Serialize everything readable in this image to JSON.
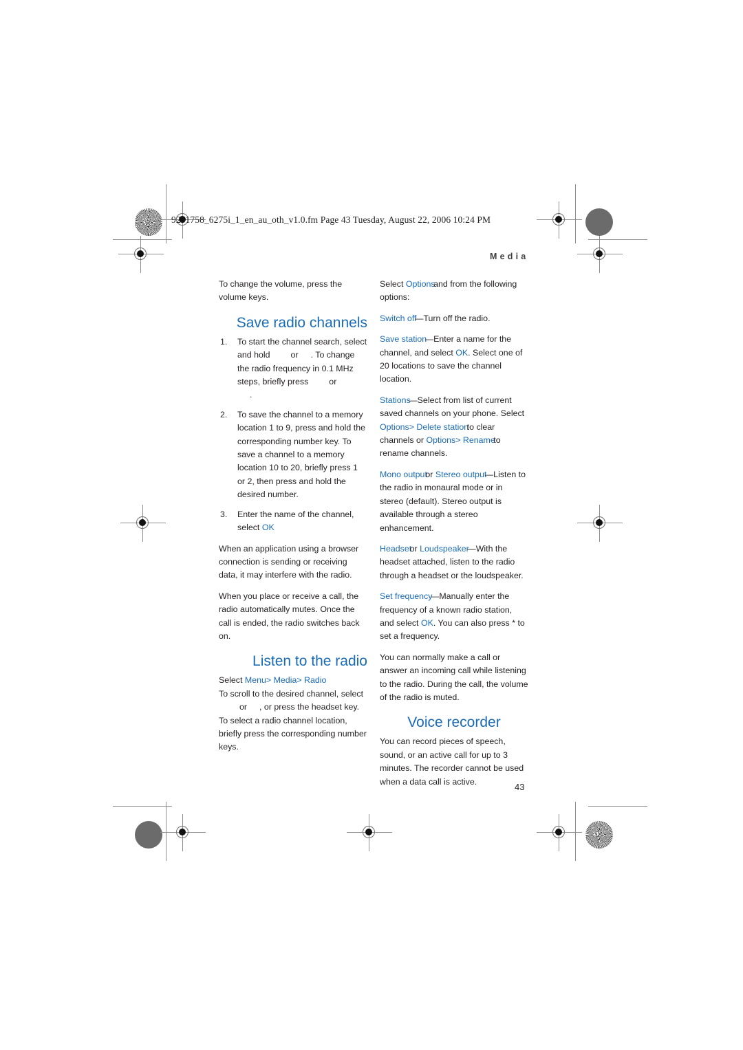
{
  "slug": "9251758_6275i_1_en_au_oth_v1.0.fm  Page 43  Tuesday, August 22, 2006  10:24 PM",
  "running_head": "Media",
  "folio": "43",
  "accent_color": "#1a6bb5",
  "text_color": "#231f20",
  "left_column": {
    "intro_paragraph": "To change the volume, press the volume keys.",
    "heading_save": "Save radio channels",
    "steps": [
      {
        "lines": [
          "To start the channel search,",
          "select and hold",
          "or",
          ".",
          "To change the radio frequency in",
          "0.1 MHz steps, briefly press",
          "or",
          "."
        ],
        "text_a": "To start the channel search, select and hold",
        "text_b": "or",
        "text_c": ".",
        "text_d": "To change the radio frequency in 0.1 MHz steps, briefly press",
        "text_e": "or",
        "text_f": "."
      },
      {
        "text": "To save the channel to a memory location 1 to 9, press and hold the corresponding number key. To save a channel to a memory location 10 to 20, briefly press 1 or 2, then press and hold the desired number."
      },
      {
        "text_before": "Enter the name of the channel, select",
        "ui": "OK"
      }
    ],
    "paragraph_browser": "When an application using a browser connection is sending or receiving data, it may interfere with the radio.",
    "paragraph_call": "When you place or receive a call, the radio automatically mutes. Once the call is ended, the radio switches back on.",
    "heading_listen": "Listen to the radio",
    "listen_select_label": "Select",
    "listen_ui_menu": "Menu",
    "listen_sep1": ">",
    "listen_ui_media": "Media",
    "listen_sep2": ">",
    "listen_ui_radio": "Radio",
    "listen_body_a": "To scroll to the desired channel, select",
    "listen_body_b": "or",
    "listen_body_c": ", or press the headset key. To select a radio channel location, briefly press the corresponding number keys."
  },
  "right_column": {
    "intro_select": "Select",
    "intro_ui": "Options",
    "intro_rest": "and from the following options:",
    "options": [
      {
        "ui": "Switch off",
        "dash": "—",
        "text": "Turn off the radio."
      },
      {
        "ui": "Save station",
        "dash": "—",
        "text_a": "Enter a name for the channel, and select",
        "ui_2": "OK",
        "text_b": ". Select one of 20 locations to save the channel location."
      },
      {
        "ui": "Stations",
        "dash": "—",
        "text_a": "Select from list of current saved channels on your phone. Select",
        "ui_2": "Options",
        "sep_1": ">",
        "ui_3": "Delete station",
        "text_b": "to clear channels or",
        "ui_4": "Options",
        "sep_2": ">",
        "ui_5": "Rename",
        "text_c": "to rename channels."
      },
      {
        "ui": "Mono output",
        "joiner": "or",
        "ui_2": "Stereo output",
        "dash": "—",
        "text": "Listen to the radio in monaural mode or in stereo (default). Stereo output is available through a stereo enhancement."
      },
      {
        "ui": "Headset",
        "joiner": "or",
        "ui_2": "Loudspeaker",
        "dash": "—",
        "text": "With the headset attached, listen to the radio through a headset or the loudspeaker."
      },
      {
        "ui": "Set frequency",
        "dash": "—",
        "text_a": "Manually enter the frequency of a known radio station, and select",
        "ui_2": "OK",
        "text_b": ". You can also press * to set a frequency."
      }
    ],
    "paragraph_call": "You can normally make a call or answer an incoming call while listening to the radio. During the call, the volume of the radio is muted.",
    "heading_voice": "Voice recorder",
    "paragraph_voice": "You can record pieces of speech, sound, or an active call for up to 3 minutes. The recorder cannot be used when a data call is active."
  }
}
